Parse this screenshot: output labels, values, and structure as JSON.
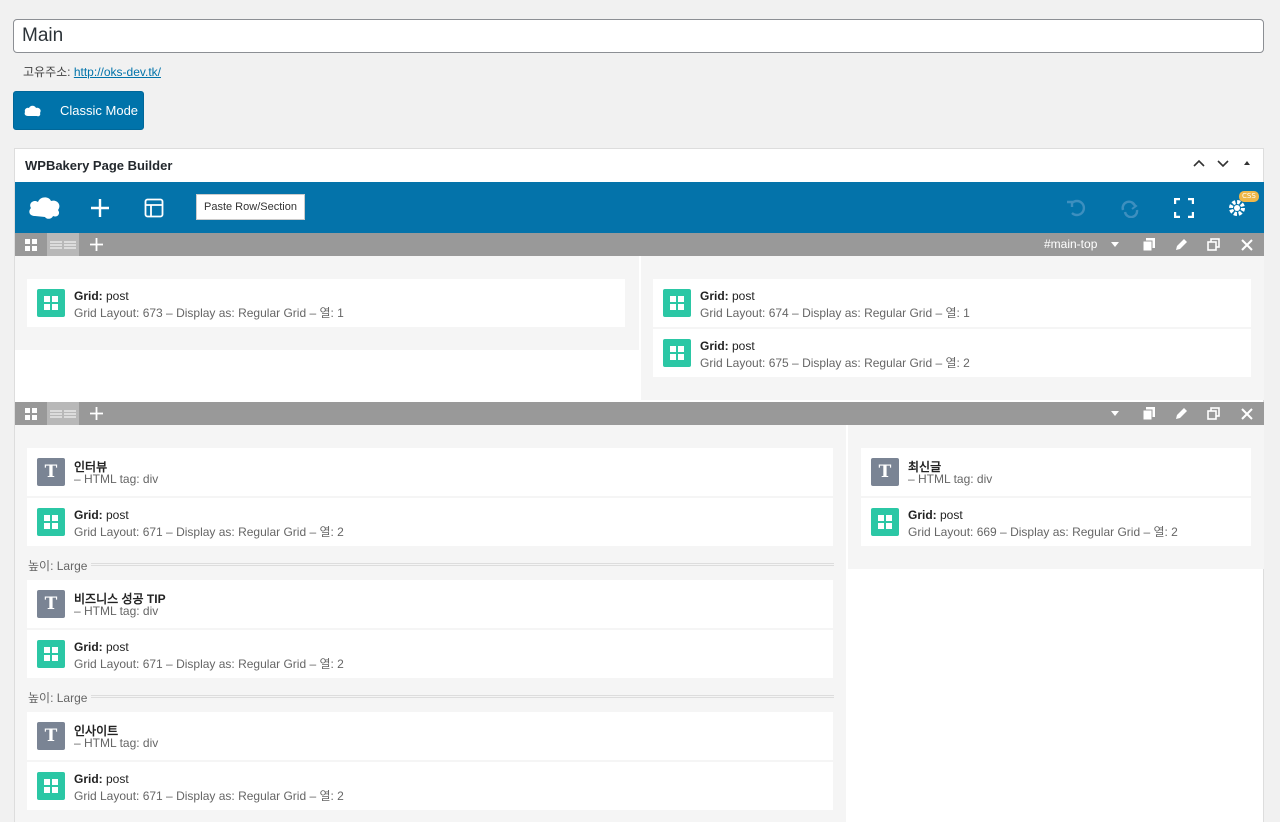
{
  "title": {
    "value": "Main"
  },
  "permalink": {
    "label": "고유주소:",
    "url": "http://oks-dev.tk/"
  },
  "classic_button": {
    "label": "Classic Mode",
    "icon": "cloud-icon"
  },
  "builder": {
    "header_title": "WPBakery Page Builder",
    "header_controls": [
      "chevron-up-icon",
      "chevron-down-icon",
      "collapse-triangle-icon"
    ],
    "toolbar": {
      "paste_label": "Paste Row/Section",
      "css_badge": "CSS",
      "icons": [
        "wpbakery-logo-icon",
        "add-element-icon",
        "templates-icon",
        "undo-icon",
        "redo-icon",
        "fullscreen-icon",
        "settings-icon"
      ]
    },
    "rows": [
      {
        "row_id_label": "#main-top",
        "columns": [
          {
            "elements": [
              {
                "type": "grid",
                "title_bold": "Grid:",
                "title_rest": " post",
                "sub": "Grid Layout: 673  –  Display as: Regular Grid   –  열: 1"
              }
            ]
          },
          {
            "elements": [
              {
                "type": "grid",
                "title_bold": "Grid:",
                "title_rest": " post",
                "sub": "Grid Layout: 674  –  Display as: Regular Grid   –  열: 1"
              },
              {
                "type": "grid",
                "title_bold": "Grid:",
                "title_rest": " post",
                "sub": "Grid Layout: 675  –  Display as: Regular Grid   –  열: 2"
              }
            ]
          }
        ]
      },
      {
        "row_id_label": "",
        "columns": [
          {
            "elements": [
              {
                "type": "text",
                "title_bold": "인터뷰",
                "title_rest": "",
                "sub": "–  HTML tag: div"
              },
              {
                "type": "grid",
                "title_bold": "Grid:",
                "title_rest": " post",
                "sub": "Grid Layout: 671  –  Display as: Regular Grid   –  열: 2"
              },
              {
                "type": "separator",
                "label": "높이: Large"
              },
              {
                "type": "text",
                "title_bold": "비즈니스 성공 TIP",
                "title_rest": "",
                "sub": "–  HTML tag: div"
              },
              {
                "type": "grid",
                "title_bold": "Grid:",
                "title_rest": " post",
                "sub": "Grid Layout: 671  –  Display as: Regular Grid   –  열: 2"
              },
              {
                "type": "separator",
                "label": "높이: Large"
              },
              {
                "type": "text",
                "title_bold": "인사이트",
                "title_rest": "",
                "sub": "–  HTML tag: div"
              },
              {
                "type": "grid",
                "title_bold": "Grid:",
                "title_rest": " post",
                "sub": "Grid Layout: 671  –  Display as: Regular Grid   –  열: 2"
              }
            ]
          },
          {
            "elements": [
              {
                "type": "text",
                "title_bold": "최신글",
                "title_rest": "",
                "sub": "–  HTML tag: div"
              },
              {
                "type": "grid",
                "title_bold": "Grid:",
                "title_rest": " post",
                "sub": "Grid Layout: 669  –  Display as: Regular Grid   –  열: 2"
              }
            ]
          }
        ]
      }
    ]
  }
}
